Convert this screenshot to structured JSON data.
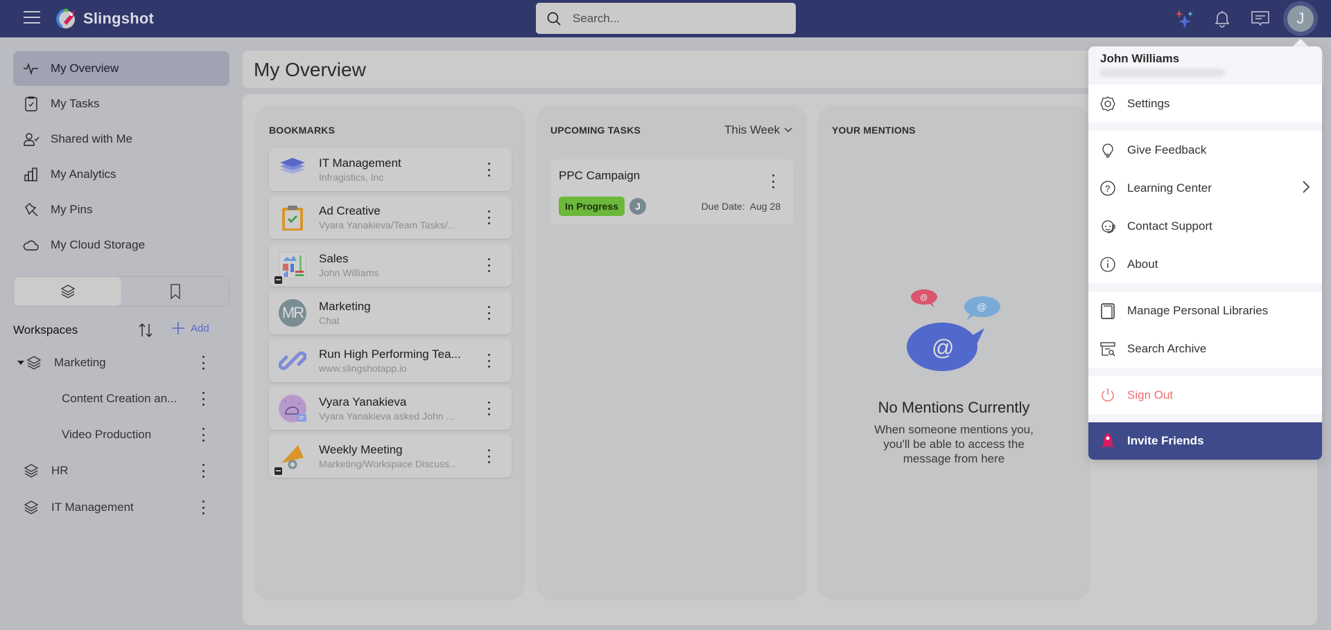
{
  "header": {
    "app_name": "Slingshot",
    "search_placeholder": "Search...",
    "avatar_initial": "J"
  },
  "sidebar": {
    "nav": [
      {
        "label": "My Overview",
        "icon": "activity-icon",
        "active": true
      },
      {
        "label": "My Tasks",
        "icon": "clipboard-check-icon"
      },
      {
        "label": "Shared with Me",
        "icon": "user-check-icon"
      },
      {
        "label": "My Analytics",
        "icon": "bar-chart-icon"
      },
      {
        "label": "My Pins",
        "icon": "pin-icon"
      },
      {
        "label": "My Cloud Storage",
        "icon": "cloud-icon"
      }
    ],
    "workspaces_title": "Workspaces",
    "add_label": "Add",
    "workspaces": [
      {
        "label": "Marketing",
        "expanded": true
      },
      {
        "label": "Content Creation an...",
        "child": true
      },
      {
        "label": "Video Production",
        "child": true
      },
      {
        "label": "HR"
      },
      {
        "label": "IT Management"
      }
    ]
  },
  "main": {
    "title": "My Overview",
    "bookmarks": {
      "title": "BOOKMARKS",
      "items": [
        {
          "name": "IT Management",
          "sub": "Infragistics, Inc"
        },
        {
          "name": "Ad Creative",
          "sub": "Vyara Yanakieva/Team Tasks/..."
        },
        {
          "name": "Sales",
          "sub": "John Williams"
        },
        {
          "name": "Marketing",
          "sub": "Chat",
          "avatar_text": "MR"
        },
        {
          "name": "Run High Performing Tea...",
          "sub": "www.slingshotapp.io"
        },
        {
          "name": "Vyara Yanakieva",
          "sub": "Vyara Yanakieva asked John ..."
        },
        {
          "name": "Weekly Meeting",
          "sub": "Marketing/Workspace Discuss..."
        }
      ]
    },
    "tasks": {
      "title": "UPCOMING TASKS",
      "filter": "This Week",
      "items": [
        {
          "name": "PPC Campaign",
          "status": "In Progress",
          "assignee": "J",
          "due_label": "Due Date:",
          "due": "Aug 28"
        }
      ]
    },
    "mentions": {
      "title": "YOUR MENTIONS",
      "empty_title": "No Mentions Currently",
      "empty_text": "When someone mentions you, you'll be able to access the message from here"
    }
  },
  "user_menu": {
    "user_name": "John Williams",
    "groups": [
      [
        {
          "label": "Settings",
          "icon": "gear-icon"
        }
      ],
      [
        {
          "label": "Give Feedback",
          "icon": "lightbulb-icon"
        },
        {
          "label": "Learning Center",
          "icon": "help-circle-icon",
          "submenu": true
        },
        {
          "label": "Contact Support",
          "icon": "headset-icon"
        },
        {
          "label": "About",
          "icon": "info-icon"
        }
      ],
      [
        {
          "label": "Manage Personal Libraries",
          "icon": "book-icon"
        },
        {
          "label": "Search Archive",
          "icon": "archive-search-icon"
        }
      ],
      [
        {
          "label": "Sign Out",
          "icon": "power-icon"
        }
      ]
    ],
    "invite_label": "Invite Friends"
  },
  "colors": {
    "header_bg": "#2f376b",
    "accent": "#5a68c4",
    "status_in_progress": "#6bb83a",
    "sign_out": "#ef6c6c",
    "invite_bg": "#3e4a8a"
  }
}
